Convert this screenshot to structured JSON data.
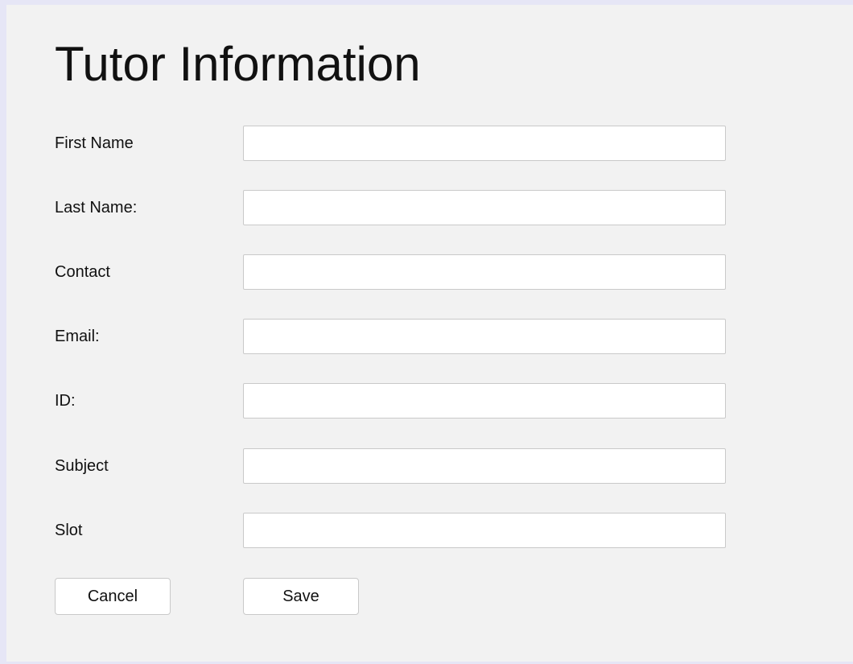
{
  "form": {
    "title": "Tutor Information",
    "fields": [
      {
        "label": "First Name",
        "value": "",
        "placeholder": ""
      },
      {
        "label": "Last Name:",
        "value": "",
        "placeholder": ""
      },
      {
        "label": "Contact",
        "value": "",
        "placeholder": ""
      },
      {
        "label": "Email:",
        "value": "",
        "placeholder": ""
      },
      {
        "label": "ID:",
        "value": "",
        "placeholder": ""
      },
      {
        "label": "Subject",
        "value": "",
        "placeholder": ""
      },
      {
        "label": "Slot",
        "value": "",
        "placeholder": ""
      }
    ],
    "cancel_label": "Cancel",
    "save_label": "Save"
  }
}
